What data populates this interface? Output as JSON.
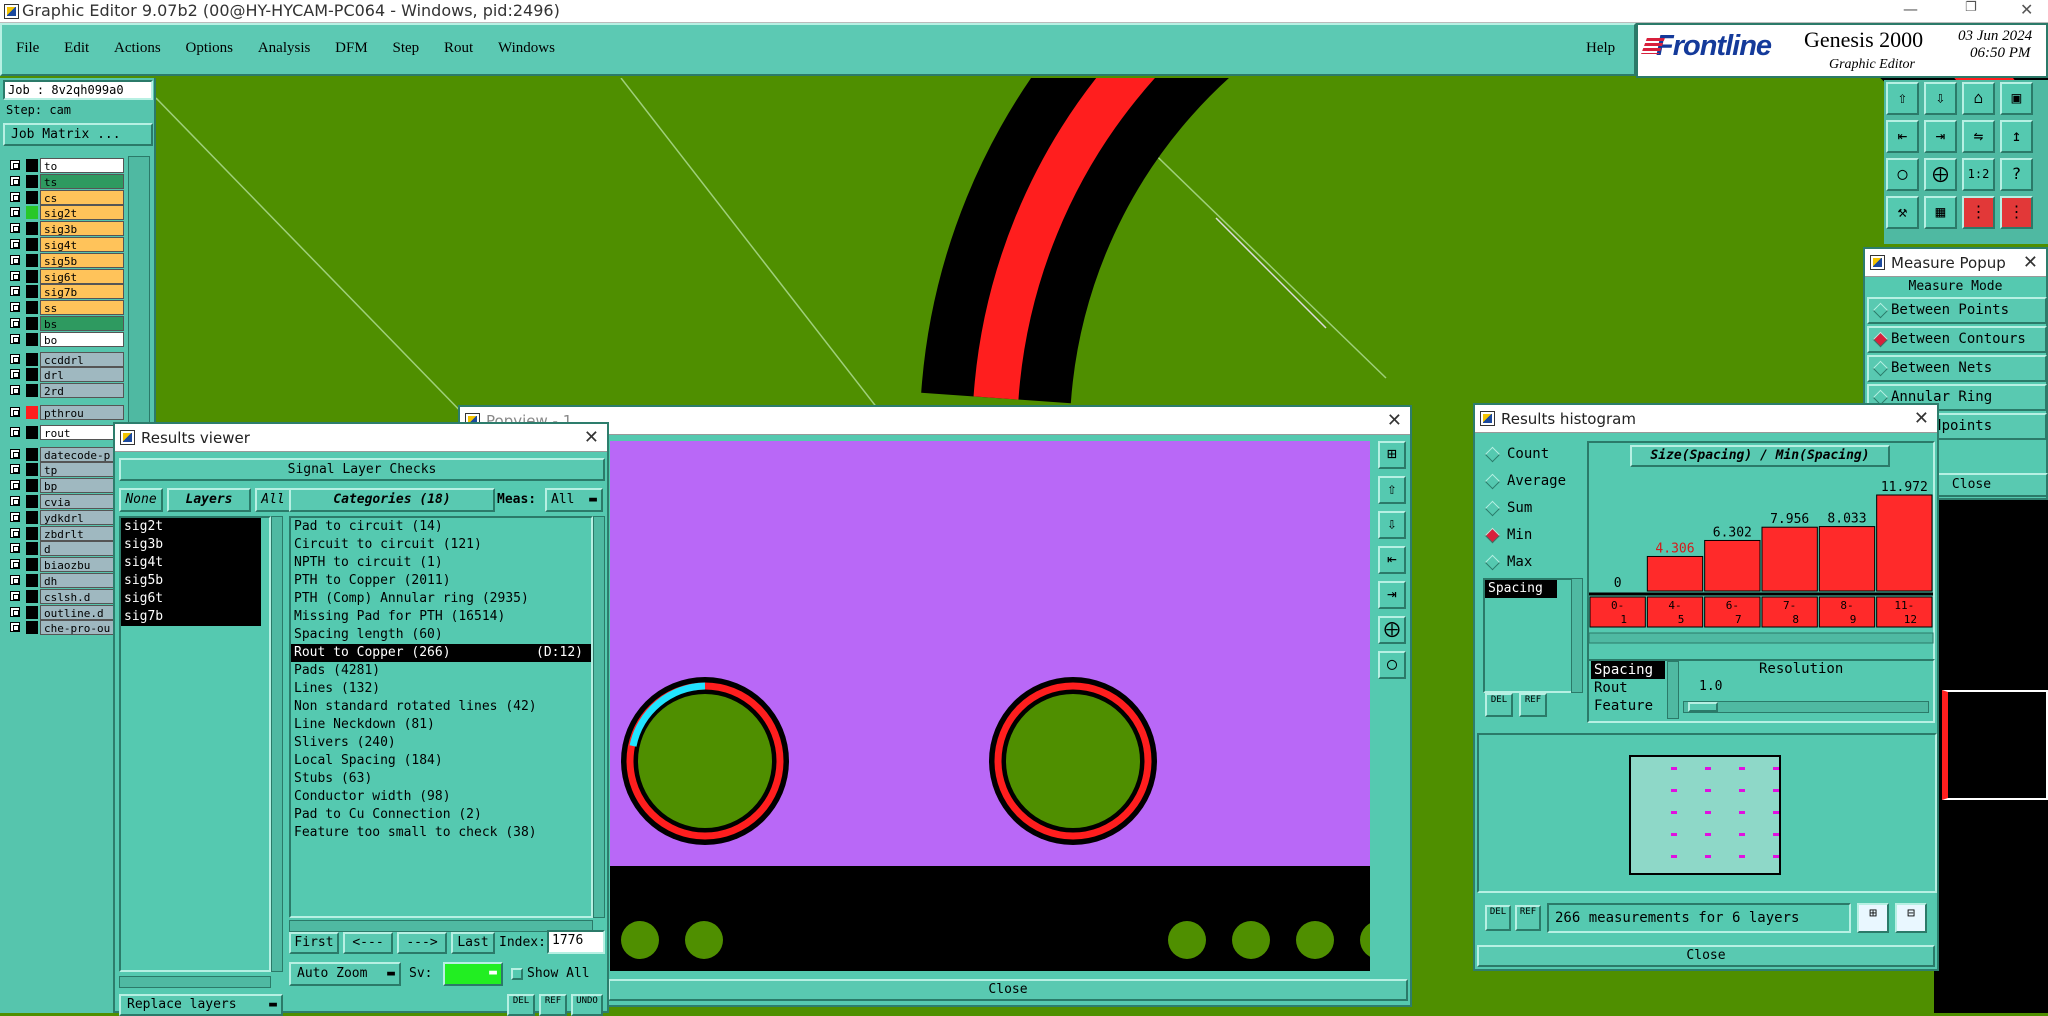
{
  "window": {
    "title": "Graphic Editor 9.07b2 (00@HY-HYCAM-PC064 - Windows, pid:2496)"
  },
  "menu": [
    "File",
    "Edit",
    "Actions",
    "Options",
    "Analysis",
    "DFM",
    "Step",
    "Rout",
    "Windows"
  ],
  "help_label": "Help",
  "brand": {
    "logo": "Frontline",
    "product": "Genesis 2000",
    "subtitle": "Graphic Editor",
    "date": "03 Jun 2024",
    "time": "06:50 PM"
  },
  "job": {
    "job_label": "Job : 8v2qh099a0",
    "step_label": "Step: cam",
    "matrix_button": "Job Matrix ..."
  },
  "layers": [
    {
      "name": "to",
      "color": "#ffffff"
    },
    {
      "name": "ts",
      "color": "#2e9a60"
    },
    {
      "name": "cs",
      "color": "#ffc35a"
    },
    {
      "name": "sig2t",
      "color": "#ffc35a"
    },
    {
      "name": "sig3b",
      "color": "#ffc35a"
    },
    {
      "name": "sig4t",
      "color": "#ffc35a"
    },
    {
      "name": "sig5b",
      "color": "#ffc35a"
    },
    {
      "name": "sig6t",
      "color": "#ffc35a"
    },
    {
      "name": "sig7b",
      "color": "#ffc35a"
    },
    {
      "name": "ss",
      "color": "#ffc35a"
    },
    {
      "name": "bs",
      "color": "#2e9a60"
    },
    {
      "name": "bo",
      "color": "#ffffff"
    },
    {
      "name": "ccddrl",
      "color": "#9fb8c0"
    },
    {
      "name": "drl",
      "color": "#9fb8c0"
    },
    {
      "name": "2rd",
      "color": "#9fb8c0"
    },
    {
      "name": "pthrou",
      "color": "#9fb8c0"
    },
    {
      "name": "rout",
      "color": "#ffffff"
    },
    {
      "name": "datecode-p",
      "color": "#9fb8c0"
    },
    {
      "name": "tp",
      "color": "#9fb8c0"
    },
    {
      "name": "bp",
      "color": "#9fb8c0"
    },
    {
      "name": "cvia",
      "color": "#9fb8c0"
    },
    {
      "name": "ydkdrl",
      "color": "#9fb8c0"
    },
    {
      "name": "zbdrlt",
      "color": "#9fb8c0"
    },
    {
      "name": "d",
      "color": "#9fb8c0"
    },
    {
      "name": "biaozbu",
      "color": "#9fb8c0"
    },
    {
      "name": "dh",
      "color": "#9fb8c0"
    },
    {
      "name": "cslsh.d",
      "color": "#9fb8c0"
    },
    {
      "name": "outline.d",
      "color": "#9fb8c0"
    },
    {
      "name": "che-pro-ou",
      "color": "#9fb8c0"
    }
  ],
  "results_viewer": {
    "title": "Results viewer",
    "header": "Signal Layer Checks",
    "none_btn": "None",
    "layers_btn": "Layers",
    "all_btn": "All",
    "categories_btn": "Categories (18)",
    "meas_label": "Meas:",
    "meas_value": "All",
    "layer_list": [
      "sig2t",
      "sig3b",
      "sig4t",
      "sig5b",
      "sig6t",
      "sig7b"
    ],
    "categories": [
      "Pad to circuit (14)",
      "Circuit to circuit (121)",
      "NPTH to circuit (1)",
      "PTH to Copper (2011)",
      "PTH (Comp) Annular ring (2935)",
      "Missing Pad for PTH (16514)",
      "Spacing length (60)",
      "Rout to Copper (266)",
      "Pads (4281)",
      "Lines (132)",
      "Non standard rotated lines (42)",
      "Line Neckdown (81)",
      "Slivers (240)",
      "Local Spacing (184)",
      "Stubs (63)",
      "Conductor width (98)",
      "Pad to Cu Connection (2)",
      "Feature too small to check (38)"
    ],
    "selected_suffix": "(D:12)",
    "first_btn": "First",
    "prev_btn": "<---",
    "next_btn": "--->",
    "last_btn": "Last",
    "index_label": "Index:",
    "index_value": "1776",
    "auto_zoom": "Auto Zoom",
    "sv_label": "Sv:",
    "show_all": "Show All",
    "replace_layers": "Replace layers",
    "del": "DEL",
    "ref": "REF",
    "undo": "UNDO"
  },
  "popview": {
    "title": "Popview - 1",
    "close": "Close"
  },
  "measure_popup": {
    "title": "Measure Popup",
    "mode_label": "Measure Mode",
    "options": [
      {
        "label": "Between Points",
        "on": false
      },
      {
        "label": "Between Contours",
        "on": true
      },
      {
        "label": "Between Nets",
        "on": false
      },
      {
        "label": "Annular Ring",
        "on": false
      },
      {
        "label": "en Midpoints",
        "on": false
      }
    ],
    "close": "Close"
  },
  "histogram": {
    "title": "Results histogram",
    "chart_title": "Size(Spacing) / Min(Spacing)",
    "stats": [
      {
        "label": "Count",
        "on": false
      },
      {
        "label": "Average",
        "on": false
      },
      {
        "label": "Sum",
        "on": false
      },
      {
        "label": "Min",
        "on": true
      },
      {
        "label": "Max",
        "on": false
      }
    ],
    "list_item": "Spacing",
    "res_items": [
      "Spacing",
      "Rout",
      "Feature"
    ],
    "resolution_label": "Resolution",
    "resolution_value": "1.0",
    "summary": "266 measurements for 6 layers",
    "close": "Close",
    "del": "DEL",
    "ref": "REF"
  },
  "chart_data": {
    "type": "bar",
    "title": "Size(Spacing) / Min(Spacing)",
    "categories": [
      "0-1",
      "4-5",
      "6-7",
      "7-8",
      "8-9",
      "11-12"
    ],
    "tick_labels": [
      [
        "0-",
        "1"
      ],
      [
        "4-",
        "5"
      ],
      [
        "6-",
        "7"
      ],
      [
        "7-",
        "8"
      ],
      [
        "8-",
        "9"
      ],
      [
        "11-",
        "12"
      ]
    ],
    "values": [
      0,
      4.306,
      6.302,
      7.956,
      8.033,
      11.972
    ],
    "value_labels": [
      "0",
      "4.306",
      "6.302",
      "7.956",
      "8.033",
      "11.972"
    ],
    "ylim": [
      0,
      11.972
    ],
    "highlight_index": 1,
    "colors": {
      "bar": "#ff2a2a",
      "highlight_label": "#d41a1a"
    }
  }
}
